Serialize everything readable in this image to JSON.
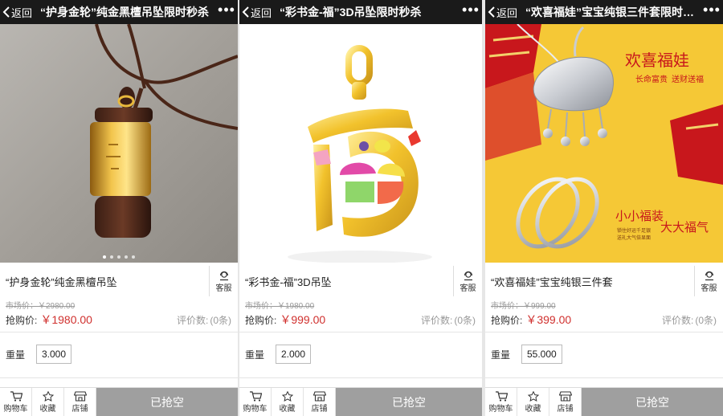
{
  "panels": [
    {
      "back_label": "返回",
      "title": "“护身金轮”纯金黑檀吊坠限时秒杀",
      "product_name": "“护身金轮”纯金黑檀吊坠",
      "service_label": "客服",
      "market_price": "市场价：￥2980.00",
      "buy_label": "抢购价:",
      "buy_price": "￥1980.00",
      "rating_label": "评价数:",
      "rating_count": "(0条)",
      "weight_label": "重量",
      "weight_value": "3.000",
      "cart_label": "购物车",
      "favorite_label": "收藏",
      "shop_label": "店铺",
      "sold_out_label": "已抢空",
      "carousel": {
        "count": 5,
        "active_index": 0
      }
    },
    {
      "back_label": "返回",
      "title": "“彩书金-福”3D吊坠限时秒杀",
      "product_name": "“彩书金-福”3D吊坠",
      "service_label": "客服",
      "market_price": "市场价：￥1980.00",
      "buy_label": "抢购价:",
      "buy_price": "￥999.00",
      "rating_label": "评价数:",
      "rating_count": "(0条)",
      "weight_label": "重量",
      "weight_value": "2.000",
      "cart_label": "购物车",
      "favorite_label": "收藏",
      "shop_label": "店铺",
      "sold_out_label": "已抢空"
    },
    {
      "back_label": "返回",
      "title": "“欢喜福娃”宝宝纯银三件套限时秒杀",
      "product_name": "“欢喜福娃”宝宝纯银三件套",
      "service_label": "客服",
      "market_price": "市场价：￥999.00",
      "buy_label": "抢购价:",
      "buy_price": "￥399.00",
      "rating_label": "评价数:",
      "rating_count": "(0条)",
      "weight_label": "重量",
      "weight_value": "55.000",
      "cart_label": "购物车",
      "favorite_label": "收藏",
      "shop_label": "店铺",
      "sold_out_label": "已抢空",
      "poster": {
        "headline": "欢喜福娃",
        "sub_left": "长命富贵",
        "sub_right": "送财送福",
        "slogan_a": "小小福装",
        "slogan_b": "大大福气",
        "small_1": "锁住好运千足银",
        "small_2": "送礼大气倍显面"
      }
    }
  ],
  "colors": {
    "topbar": "#1a1a1a",
    "price_red": "#d0302e",
    "sold_out_bg": "#9f9f9f",
    "poster_yellow": "#f5c836",
    "poster_red": "#c8171c"
  }
}
